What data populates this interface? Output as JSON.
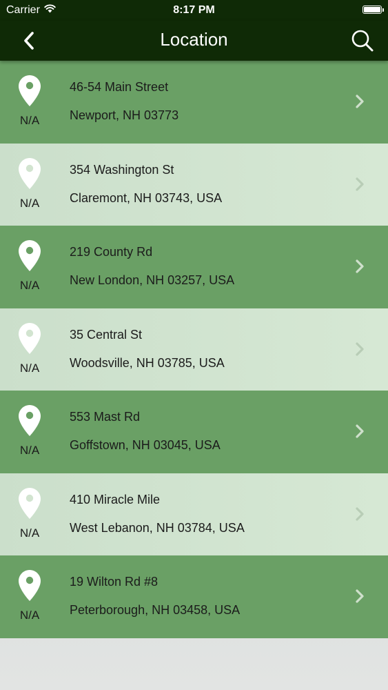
{
  "status_bar": {
    "carrier": "Carrier",
    "time": "8:17 PM"
  },
  "nav": {
    "title": "Location",
    "back_icon": "chevron-left-icon",
    "search_icon": "search-icon"
  },
  "colors": {
    "nav_bg": "#0f2a06",
    "row_dark": "#6aa065",
    "row_light": "#d6e8d4",
    "pin_white": "#ffffff"
  },
  "locations": [
    {
      "street": "46-54 Main Street",
      "city": "Newport, NH 03773",
      "distance": "N/A"
    },
    {
      "street": "354 Washington St",
      "city": "Claremont, NH 03743, USA",
      "distance": "N/A"
    },
    {
      "street": "219 County Rd",
      "city": "New London, NH 03257, USA",
      "distance": "N/A"
    },
    {
      "street": "35 Central St",
      "city": "Woodsville, NH 03785, USA",
      "distance": "N/A"
    },
    {
      "street": "553 Mast Rd",
      "city": "Goffstown, NH 03045, USA",
      "distance": "N/A"
    },
    {
      "street": "410 Miracle Mile",
      "city": "West Lebanon, NH 03784, USA",
      "distance": "N/A"
    },
    {
      "street": "19 Wilton Rd #8",
      "city": "Peterborough, NH 03458, USA",
      "distance": "N/A"
    }
  ]
}
